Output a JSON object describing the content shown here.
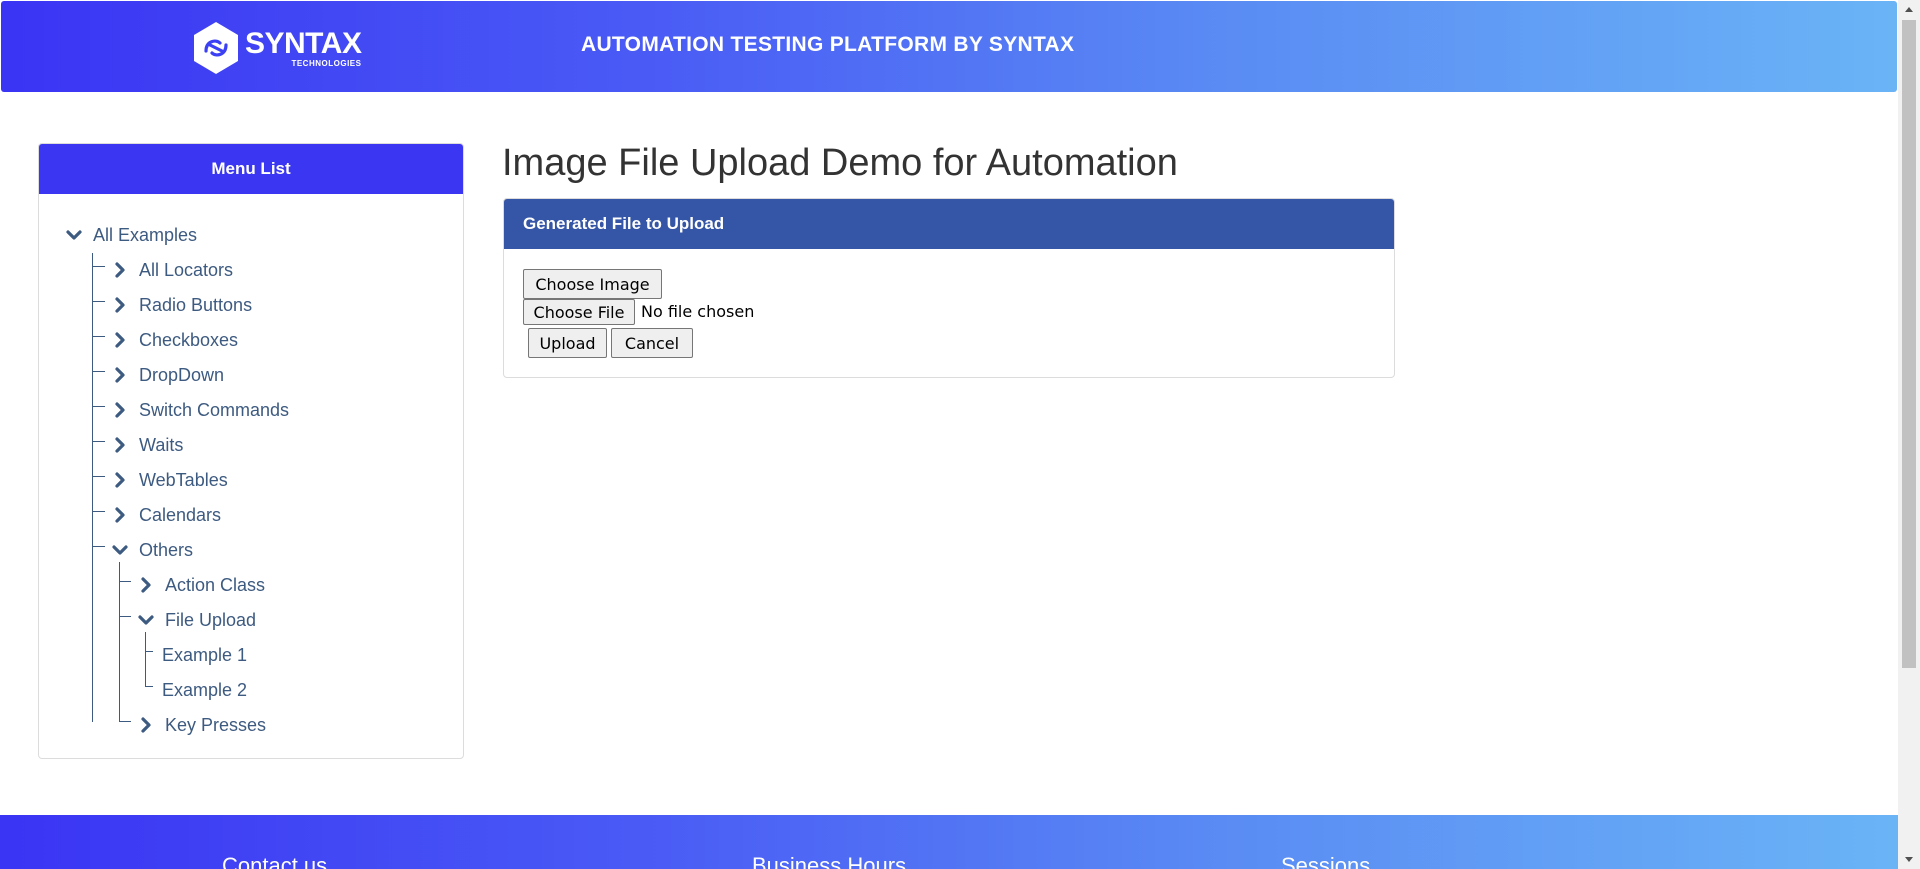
{
  "header": {
    "logo_title": "SYNTAX",
    "logo_subtitle": "TECHNOLOGIES",
    "title": "AUTOMATION TESTING PLATFORM BY SYNTAX"
  },
  "sidebar": {
    "title": "Menu List",
    "items": [
      {
        "label": "All Examples",
        "icon": "chevron-down-icon"
      },
      {
        "label": "All Locators",
        "icon": "chevron-right-icon"
      },
      {
        "label": "Radio Buttons",
        "icon": "chevron-right-icon"
      },
      {
        "label": "Checkboxes",
        "icon": "chevron-right-icon"
      },
      {
        "label": "DropDown",
        "icon": "chevron-right-icon"
      },
      {
        "label": "Switch Commands",
        "icon": "chevron-right-icon"
      },
      {
        "label": "Waits",
        "icon": "chevron-right-icon"
      },
      {
        "label": "WebTables",
        "icon": "chevron-right-icon"
      },
      {
        "label": "Calendars",
        "icon": "chevron-right-icon"
      },
      {
        "label": "Others",
        "icon": "chevron-down-icon"
      },
      {
        "label": "Action Class",
        "icon": "chevron-right-icon"
      },
      {
        "label": "File Upload",
        "icon": "chevron-down-icon"
      },
      {
        "label": "Example 1"
      },
      {
        "label": "Example 2"
      },
      {
        "label": "Key Presses",
        "icon": "chevron-right-icon"
      }
    ]
  },
  "main": {
    "title": "Image File Upload Demo for Automation",
    "card_title": "Generated File to Upload",
    "choose_image_label": "Choose Image",
    "choose_file_label": "Choose File",
    "file_status": "No file chosen",
    "upload_label": "Upload",
    "cancel_label": "Cancel"
  },
  "footer": {
    "columns": [
      "Contact us",
      "Business Hours",
      "Sessions"
    ]
  },
  "colors": {
    "header_gradient_start": "#3a34f4",
    "header_gradient_end": "#6ab4f6",
    "sidebar_header": "#3b36f2",
    "card_header": "#3556a6",
    "tree_text": "#3d5a80"
  }
}
